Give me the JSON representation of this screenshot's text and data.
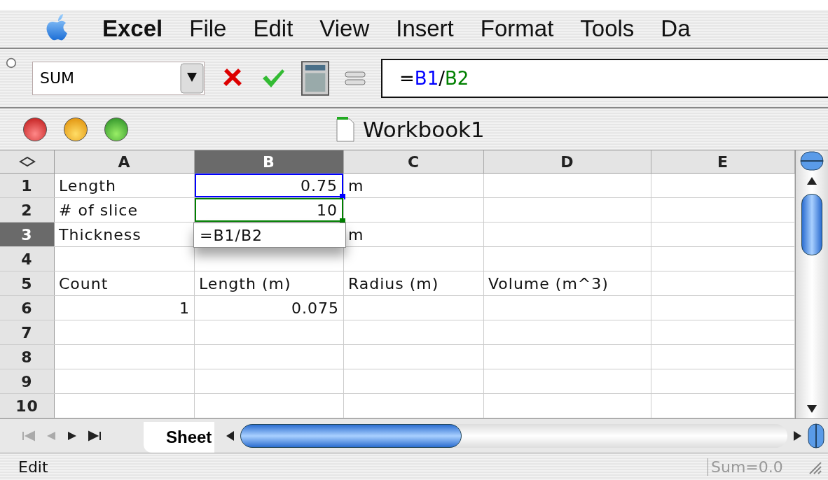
{
  "menu_bar": {
    "items": [
      {
        "label": "Excel",
        "bold": true
      },
      {
        "label": "File",
        "bold": false
      },
      {
        "label": "Edit",
        "bold": false
      },
      {
        "label": "View",
        "bold": false
      },
      {
        "label": "Insert",
        "bold": false
      },
      {
        "label": "Format",
        "bold": false
      },
      {
        "label": "Tools",
        "bold": false
      },
      {
        "label": "Da",
        "bold": false
      }
    ]
  },
  "formula_bar": {
    "name_box": "SUM",
    "formula": [
      {
        "text": "=",
        "color": "#000000"
      },
      {
        "text": "B1",
        "color": "#0000ff"
      },
      {
        "text": "/",
        "color": "#000000"
      },
      {
        "text": "B2",
        "color": "#008000"
      }
    ]
  },
  "window": {
    "title": "Workbook1"
  },
  "columns": [
    {
      "label": "A",
      "selected": false
    },
    {
      "label": "B",
      "selected": true
    },
    {
      "label": "C",
      "selected": false
    },
    {
      "label": "D",
      "selected": false
    },
    {
      "label": "E",
      "selected": false
    }
  ],
  "rows": [
    {
      "label": "1",
      "selected": false,
      "cells": [
        {
          "kind": "text",
          "text": "Length"
        },
        {
          "kind": "number",
          "text": "0.75",
          "color": "#0000ff"
        },
        {
          "kind": "text",
          "text": "m"
        },
        {
          "kind": "empty"
        },
        {
          "kind": "empty"
        }
      ]
    },
    {
      "label": "2",
      "selected": false,
      "cells": [
        {
          "kind": "text",
          "text": "# of slice"
        },
        {
          "kind": "number",
          "text": "10",
          "color": "#008000"
        },
        {
          "kind": "empty"
        },
        {
          "kind": "empty"
        },
        {
          "kind": "empty"
        }
      ]
    },
    {
      "label": "3",
      "selected": true,
      "cells": [
        {
          "kind": "text",
          "text": "Thickness"
        },
        {
          "kind": "editor",
          "text": "=B1/B2"
        },
        {
          "kind": "text",
          "text": "m"
        },
        {
          "kind": "empty"
        },
        {
          "kind": "empty"
        }
      ]
    },
    {
      "label": "4",
      "selected": false,
      "cells": [
        {
          "kind": "empty"
        },
        {
          "kind": "empty"
        },
        {
          "kind": "empty"
        },
        {
          "kind": "empty"
        },
        {
          "kind": "empty"
        }
      ]
    },
    {
      "label": "5",
      "selected": false,
      "cells": [
        {
          "kind": "text",
          "text": "Count"
        },
        {
          "kind": "text",
          "text": "Length (m)"
        },
        {
          "kind": "text",
          "text": "Radius (m)"
        },
        {
          "kind": "text",
          "text": "Volume (m^3)"
        },
        {
          "kind": "empty"
        }
      ]
    },
    {
      "label": "6",
      "selected": false,
      "cells": [
        {
          "kind": "number",
          "text": "1"
        },
        {
          "kind": "number",
          "text": "0.075"
        },
        {
          "kind": "empty"
        },
        {
          "kind": "empty"
        },
        {
          "kind": "empty"
        }
      ]
    },
    {
      "label": "7",
      "selected": false,
      "cells": [
        {
          "kind": "empty"
        },
        {
          "kind": "empty"
        },
        {
          "kind": "empty"
        },
        {
          "kind": "empty"
        },
        {
          "kind": "empty"
        }
      ]
    },
    {
      "label": "8",
      "selected": false,
      "cells": [
        {
          "kind": "empty"
        },
        {
          "kind": "empty"
        },
        {
          "kind": "empty"
        },
        {
          "kind": "empty"
        },
        {
          "kind": "empty"
        }
      ]
    },
    {
      "label": "9",
      "selected": false,
      "cells": [
        {
          "kind": "empty"
        },
        {
          "kind": "empty"
        },
        {
          "kind": "empty"
        },
        {
          "kind": "empty"
        },
        {
          "kind": "empty"
        }
      ]
    },
    {
      "label": "10",
      "selected": false,
      "cells": [
        {
          "kind": "empty"
        },
        {
          "kind": "empty"
        },
        {
          "kind": "empty"
        },
        {
          "kind": "empty"
        },
        {
          "kind": "empty"
        }
      ]
    }
  ],
  "sheet_tabs": [
    {
      "label": "Sheet",
      "selected": true
    }
  ],
  "status_bar": {
    "mode": "Edit",
    "sum": "Sum=0.0"
  }
}
